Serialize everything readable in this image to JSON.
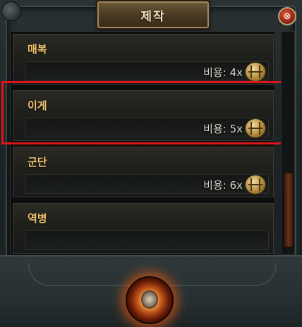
{
  "window": {
    "title": "제작",
    "close_label": "⊗"
  },
  "recipes": [
    {
      "name": "매복",
      "cost": "비용: 4x",
      "currency_icon": "gold-coin-icon"
    },
    {
      "name": "이게",
      "cost": "비용: 5x",
      "currency_icon": "gold-coin-icon"
    },
    {
      "name": "군단",
      "cost": "비용: 6x",
      "currency_icon": "gold-coin-icon"
    },
    {
      "name": "역병",
      "cost": "",
      "currency_icon": ""
    }
  ],
  "highlight": {
    "color": "#e0141a",
    "target": "이게"
  },
  "colors": {
    "title_text": "#f2e3c0",
    "recipe_name": "#f0c270",
    "cost_text": "#d7d2c5",
    "craft_glow": "#e65a14"
  },
  "craft_button": {
    "icon": "craft-orb-icon"
  }
}
